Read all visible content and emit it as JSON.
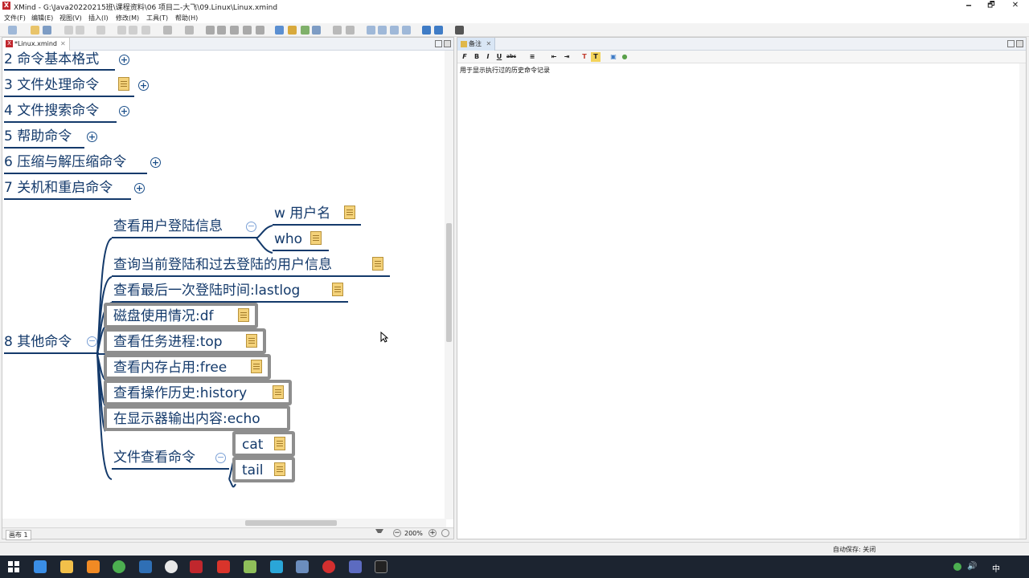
{
  "window": {
    "title": "XMind - G:\\Java20220215班\\课程资料\\06 项目二-大飞\\09.Linux\\Linux.xmind",
    "minimize": "🗕",
    "restore": "🗗",
    "close": "✕"
  },
  "menu": [
    "文件(F)",
    "编辑(E)",
    "视图(V)",
    "插入(I)",
    "修改(M)",
    "工具(T)",
    "帮助(H)"
  ],
  "editor": {
    "tab_label": "*Linux.xmind",
    "tab_close": "✕",
    "sheet_label": "画布 1",
    "zoom": "200%"
  },
  "mindmap": {
    "top_items": [
      "2 命令基本格式",
      "3 文件处理命令",
      "4 文件搜索命令",
      "5 帮助命令",
      "6 压缩与解压缩命令",
      "7 关机和重启命令"
    ],
    "root": "8 其他命令",
    "user_login": "查看用户登陆信息",
    "w_user": "w 用户名",
    "who": "who",
    "query_current": "查询当前登陆和过去登陆的用户信息",
    "last_login": "查看最后一次登陆时间:lastlog",
    "disk": "磁盘使用情况:df",
    "top": "查看任务进程:top",
    "free": "查看内存占用:free",
    "history": "查看操作历史:history",
    "echo": "在显示器输出内容:echo",
    "file_view": "文件查看命令",
    "cat": "cat",
    "tail": "tail"
  },
  "notes": {
    "tab_label": "备注",
    "tab_close": "✕",
    "text": "用于显示执行过的历史命令记录",
    "toolbar": [
      "F",
      "B",
      "I",
      "U",
      "abc",
      "≡",
      "⇤",
      "⇥",
      "T",
      "T",
      "▣",
      "●"
    ]
  },
  "statusbar": {
    "autosave": "自动保存: 关闭"
  },
  "taskbar": {
    "time_fragment": "中"
  },
  "colors": {
    "node_text": "#143a6b",
    "box_border": "#8e8e8e",
    "note_icon": "#f4d27a",
    "xmind_red": "#c0272d",
    "taskbar": "#1c2430"
  }
}
